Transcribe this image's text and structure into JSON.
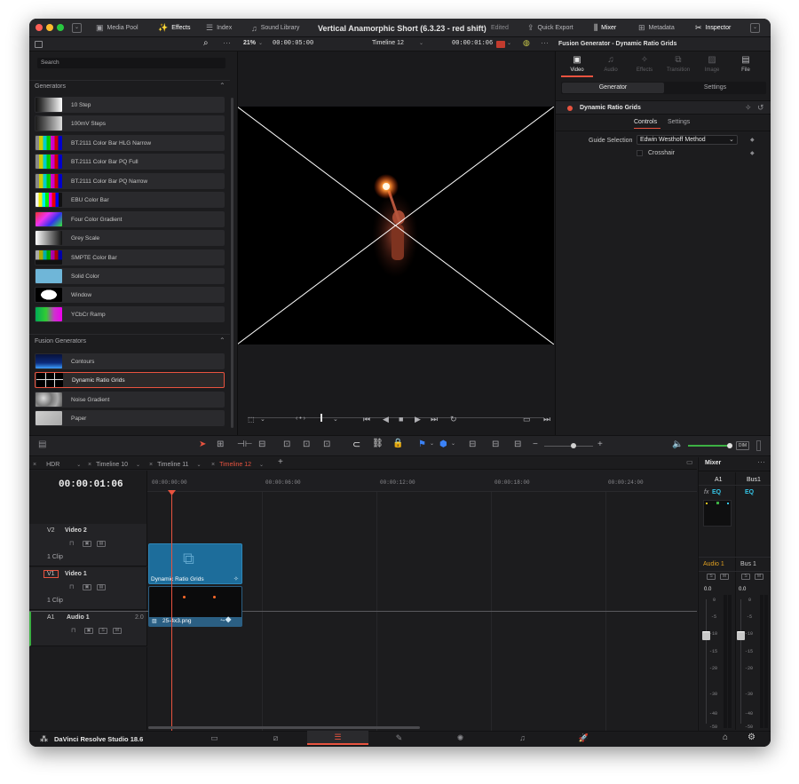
{
  "titlebar": {
    "media_pool": "Media Pool",
    "effects": "Effects",
    "index": "Index",
    "sound_library": "Sound Library",
    "project_title": "Vertical Anamorphic Short (6.3.23 - red shift)",
    "edited": "Edited",
    "quick_export": "Quick Export",
    "mixer": "Mixer",
    "metadata": "Metadata",
    "inspector": "Inspector"
  },
  "viewer_bar": {
    "zoom": "21%",
    "source_tc": "00:00:05:00",
    "timeline_name": "Timeline 12",
    "record_tc": "00:00:01:06"
  },
  "effects_panel": {
    "search_placeholder": "Search",
    "generators_header": "Generators",
    "generators": [
      "10 Step",
      "100mV Steps",
      "BT.2111 Color Bar HLG Narrow",
      "BT.2111 Color Bar PQ Full",
      "BT.2111 Color Bar PQ Narrow",
      "EBU Color Bar",
      "Four Color Gradient",
      "Grey Scale",
      "SMPTE Color Bar",
      "Solid Color",
      "Window",
      "YCbCr Ramp"
    ],
    "fusion_header": "Fusion Generators",
    "fusion_generators": [
      "Contours",
      "Dynamic Ratio Grids",
      "Noise Gradient",
      "Paper"
    ]
  },
  "inspector": {
    "header": "Fusion Generator - Dynamic Ratio Grids",
    "tabs": [
      "Video",
      "Audio",
      "Effects",
      "Transition",
      "Image",
      "File"
    ],
    "subtabs": [
      "Generator",
      "Settings"
    ],
    "tool_name": "Dynamic Ratio Grids",
    "inner_tabs": [
      "Controls",
      "Settings"
    ],
    "guide_selection_label": "Guide Selection",
    "guide_selection_value": "Edwin Westhoff Method",
    "crosshair_label": "Crosshair"
  },
  "timeline": {
    "tabs": [
      "HDR",
      "Timeline 10",
      "Timeline 11",
      "Timeline 12"
    ],
    "timecode": "00:00:01:06",
    "ruler": [
      "00:00:00:00",
      "00:00:06:00",
      "00:00:12:00",
      "00:00:18:00",
      "00:00:24:00"
    ],
    "tracks": [
      {
        "id": "V2",
        "name": "Video 2",
        "clips": "1 Clip"
      },
      {
        "id": "V1",
        "name": "Video 1",
        "clips": "1 Clip"
      },
      {
        "id": "A1",
        "name": "Audio 1",
        "channels": "2.0"
      }
    ],
    "clip_v2": "Dynamic Ratio Grids",
    "clip_v1": "25-4x3.png",
    "solo": "S",
    "mute": "M"
  },
  "mixer": {
    "title": "Mixer",
    "channels": [
      "A1",
      "Bus1"
    ],
    "fx": "fx",
    "eq": "EQ",
    "labels": [
      "Audio 1",
      "Bus 1"
    ],
    "solo": "S",
    "mute": "M",
    "level": "0.0",
    "scale": [
      "0",
      "-5",
      "-10",
      "-15",
      "-20",
      "-30",
      "-40",
      "-50"
    ]
  },
  "footer": {
    "app_name": "DaVinci Resolve Studio 18.6"
  },
  "colors": {
    "accent_red": "#e8533f",
    "playhead": "#e8533f",
    "clip_blue": "#1d6d9b",
    "clip_audio_blue": "#2b5f83",
    "meter_green": "#3cb043",
    "eq_cyan": "#35c6e8"
  }
}
